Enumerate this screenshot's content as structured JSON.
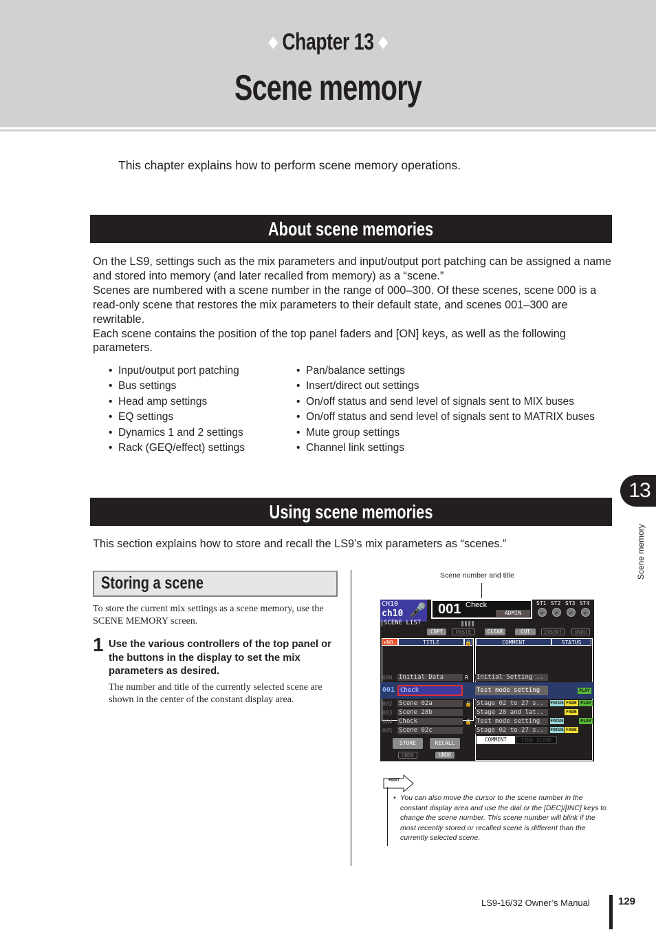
{
  "header": {
    "chapter_label": "Chapter 13",
    "title": "Scene memory"
  },
  "intro": "This chapter explains how to perform scene memory operations.",
  "section1": {
    "heading": "About scene memories",
    "paragraphs": [
      "On the LS9, settings such as the mix parameters and input/output port patching can be assigned a name and stored into memory (and later recalled from memory) as a “scene.”",
      "Scenes are numbered with a scene number in the range of 000–300. Of these scenes, scene 000 is a read-only scene that restores the mix parameters to their default state, and scenes 001–300 are rewritable.",
      "Each scene contains the position of the top panel faders and [ON] keys, as well as the following parameters."
    ],
    "bullets_left": [
      "Input/output port patching",
      "Bus settings",
      "Head amp settings",
      "EQ settings",
      "Dynamics 1 and 2 settings",
      "Rack (GEQ/effect) settings"
    ],
    "bullets_right": [
      "Pan/balance settings",
      "Insert/direct out settings",
      "On/off status and send level of signals sent to MIX buses",
      "On/off status and send level of signals sent to MATRIX buses",
      "Mute group settings",
      "Channel link settings"
    ]
  },
  "section2": {
    "heading": "Using scene memories",
    "intro": "This section explains how to store and recall the LS9’s mix parameters as “scenes.”"
  },
  "storing": {
    "heading": "Storing a scene",
    "intro": "To store the current mix settings as a scene memory, use the SCENE MEMORY screen.",
    "step_number": "1",
    "step_text": "Use the various controllers of the top panel or the buttons in the display to set the mix parameters as desired.",
    "step_detail": "The number and title of the currently selected scene are shown in the center of the constant display area."
  },
  "figure": {
    "callout": "Scene number and title",
    "channel": {
      "line1": "CH10",
      "line2": "ch10"
    },
    "scene_number": "001",
    "scene_title": "Check",
    "user": "ADMIN",
    "st_labels": [
      "ST1",
      "ST2",
      "ST3",
      "ST4"
    ],
    "screen_tab": "SCENE LIST",
    "buttons": [
      {
        "label": "COPY",
        "enabled": true
      },
      {
        "label": "PASTE",
        "enabled": false
      },
      {
        "label": "CLEAR",
        "enabled": true
      },
      {
        "label": "CUT",
        "enabled": true
      },
      {
        "label": "INSERT",
        "enabled": false
      },
      {
        "label": "UNDO",
        "enabled": false
      }
    ],
    "columns": {
      "no": "▾NO.",
      "title": "TITLE",
      "comment": "COMMENT",
      "status": "STATUS"
    },
    "rows": [
      {
        "no": "000",
        "title": "Initial Data",
        "flag": "R",
        "comment": "Initial Setting ..",
        "status": []
      },
      {
        "no": "001",
        "title": "Check",
        "flag": "",
        "comment": "Test mode setting",
        "status": [
          "PLAY"
        ]
      },
      {
        "no": "002",
        "title": "Scene 02a",
        "flag": "lock",
        "comment": "Stage 02 to 27 s..",
        "status": [
          "FOCUS",
          "FADE",
          "PLAY"
        ]
      },
      {
        "no": "003",
        "title": "Scene 28b",
        "flag": "",
        "comment": "Stage 28 and lat..",
        "status": [
          "FADE"
        ]
      },
      {
        "no": "004",
        "title": "Check",
        "flag": "lock",
        "comment": "Test mode setting",
        "status": [
          "FOCUS",
          "PLAY"
        ]
      },
      {
        "no": "005",
        "title": "Scene 02c",
        "flag": "",
        "comment": "Stage 02 to 27 s..",
        "status": [
          "FOCUS",
          "FADE"
        ]
      }
    ],
    "store_label": "STORE",
    "recall_label": "RECALL",
    "undo_label": "UNDO",
    "tab_comment": "COMMENT",
    "tab_timestamp": "TIME STAMP"
  },
  "hint": {
    "label": "HINT",
    "text": "You can also move the cursor to the scene number in the constant display area and use the dial or the [DEC]/[INC] keys to change the scene number. This scene number will blink if the most recently stored or recalled scene is different than the currently selected scene."
  },
  "side_tab": {
    "number": "13",
    "label": "Scene memory"
  },
  "footer": {
    "manual": "LS9-16/32  Owner’s Manual",
    "page": "129"
  }
}
